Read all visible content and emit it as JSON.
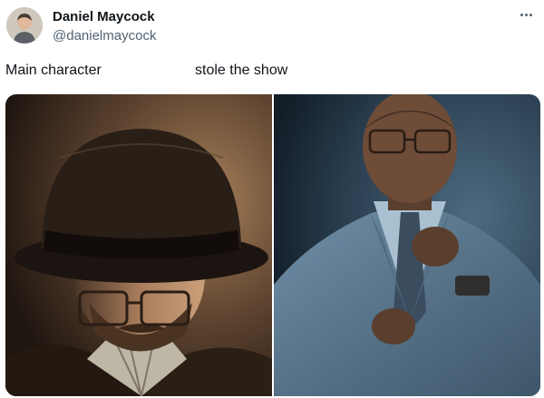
{
  "post": {
    "author_name": "Daniel Maycock",
    "author_handle": "@danielmaycock",
    "more_icon": "more-horizontal-icon"
  },
  "meme": {
    "left_caption": "Main character",
    "right_caption": "stole the show"
  },
  "colors": {
    "name": "#0f1419",
    "handle": "#536471"
  }
}
